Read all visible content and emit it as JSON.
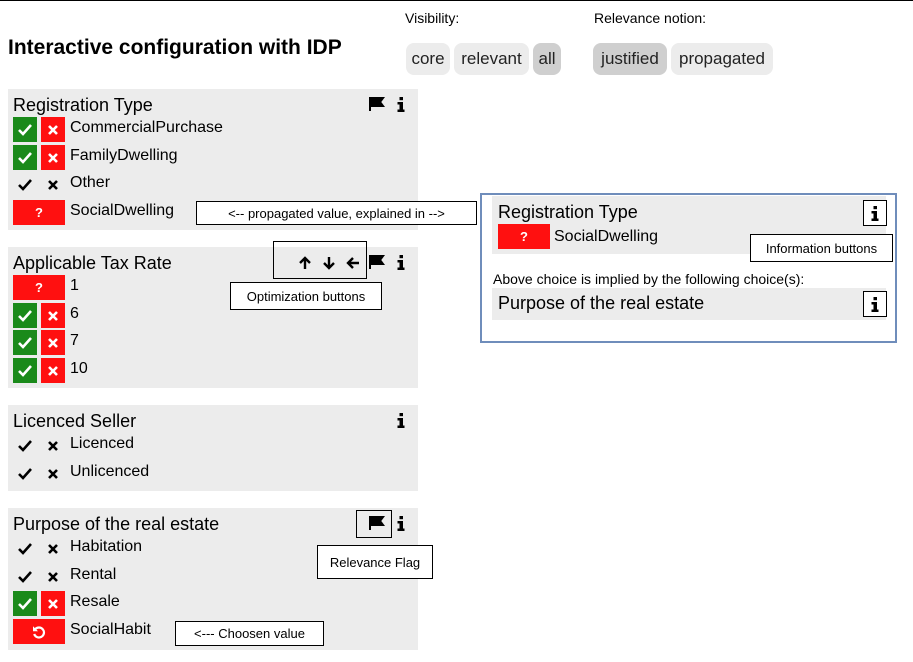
{
  "header": {
    "title": "Interactive configuration with IDP",
    "visibility_label": "Visibility:",
    "visibility_options": [
      "core",
      "relevant",
      "all"
    ],
    "visibility_selected": "all",
    "relevance_label": "Relevance notion:",
    "relevance_options": [
      "justified",
      "propagated"
    ],
    "relevance_selected": "justified"
  },
  "colors": {
    "accept": "#1a8a1a",
    "reject": "#ff1010",
    "panel": "#ececec",
    "side_border": "#6f8dbb"
  },
  "panels": [
    {
      "title": "Registration Type",
      "header_icons": [
        "flag-icon",
        "info-icon"
      ],
      "rows": [
        {
          "label": "CommercialPurchase",
          "state": "open"
        },
        {
          "label": "FamilyDwelling",
          "state": "open"
        },
        {
          "label": "Other",
          "state": "plain"
        },
        {
          "label": "SocialDwelling",
          "state": "propagated",
          "badge": "?"
        }
      ]
    },
    {
      "title": "Applicable Tax Rate",
      "header_icons": [
        "arrow-up-icon",
        "arrow-down-icon",
        "arrow-left-icon",
        "flag-icon",
        "info-icon"
      ],
      "rows": [
        {
          "label": "1",
          "state": "propagated",
          "badge": "?"
        },
        {
          "label": "6",
          "state": "open"
        },
        {
          "label": "7",
          "state": "open"
        },
        {
          "label": "10",
          "state": "open"
        }
      ]
    },
    {
      "title": "Licenced Seller",
      "header_icons": [
        "info-icon"
      ],
      "rows": [
        {
          "label": "Licenced",
          "state": "plain"
        },
        {
          "label": "Unlicenced",
          "state": "plain"
        }
      ]
    },
    {
      "title": "Purpose of the real estate",
      "header_icons": [
        "flag-icon",
        "info-icon"
      ],
      "rows": [
        {
          "label": "Habitation",
          "state": "plain"
        },
        {
          "label": "Rental",
          "state": "plain"
        },
        {
          "label": "Resale",
          "state": "open"
        },
        {
          "label": "SocialHabit",
          "state": "chosen"
        }
      ]
    }
  ],
  "explanation": {
    "title": "Registration Type",
    "value_badge": "?",
    "value": "SocialDwelling",
    "implied_text": "Above choice is implied by the following choice(s):",
    "cause": "Purpose of the real estate"
  },
  "callouts": {
    "propagated": "<--  propagated value, explained in  -->",
    "optimization": "Optimization buttons",
    "information": "Information buttons",
    "relevance": "Relevance Flag",
    "chosen": "<--- Choosen value"
  }
}
